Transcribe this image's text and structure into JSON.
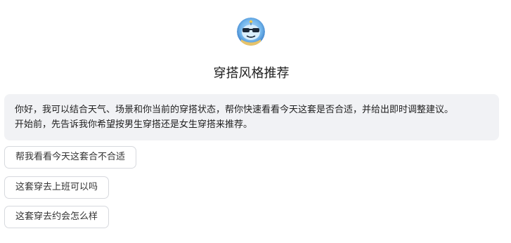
{
  "app": {
    "title": "穿搭风格推荐",
    "avatar_icon": "robot-sunglasses-avatar-icon"
  },
  "message": {
    "line1": "你好，我可以结合天气、场景和你当前的穿搭状态，帮你快速看看今天这套是否合适，并给出即时调整建议。",
    "line2": "开始前，先告诉我你希望按男生穿搭还是女生穿搭来推荐。"
  },
  "suggestions": [
    {
      "label": "帮我看看今天这套合不合适"
    },
    {
      "label": "这套穿去上班可以吗"
    },
    {
      "label": "这套穿去约会怎么样"
    }
  ],
  "colors": {
    "bubble_bg": "#f1f2f5",
    "chip_border": "#d7d9de",
    "avatar_blue": "#4a8fd6"
  }
}
